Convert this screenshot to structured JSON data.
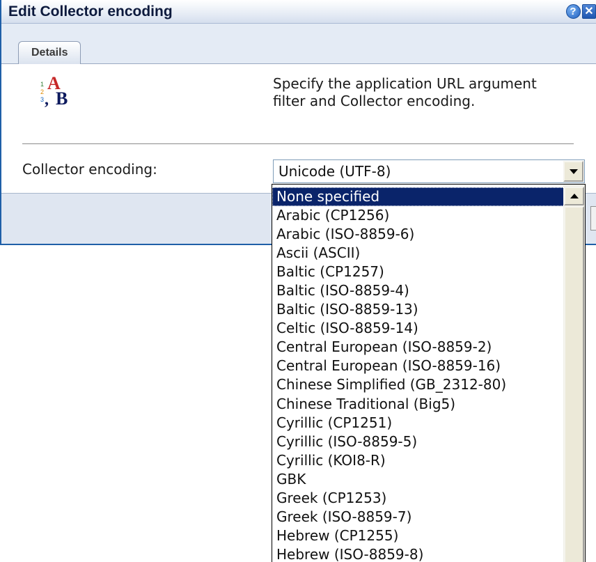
{
  "dialog": {
    "title": "Edit Collector encoding",
    "help_label": "?",
    "close_label": "✕",
    "tabs": [
      {
        "label": "Details"
      }
    ],
    "description": "Specify the application URL argument filter and Collector encoding.",
    "field_label": "Collector encoding:",
    "selected_value": "Unicode (UTF-8)"
  },
  "dropdown": {
    "options": [
      "None specified",
      "Arabic (CP1256)",
      "Arabic (ISO-8859-6)",
      "Ascii (ASCII)",
      "Baltic (CP1257)",
      "Baltic (ISO-8859-4)",
      "Baltic (ISO-8859-13)",
      "Celtic (ISO-8859-14)",
      "Central European (ISO-8859-2)",
      "Central European (ISO-8859-16)",
      "Chinese Simplified (GB_2312-80)",
      "Chinese Traditional (Big5)",
      "Cyrillic (CP1251)",
      "Cyrillic (ISO-8859-5)",
      "Cyrillic (KOI8-R)",
      "GBK",
      "Greek (CP1253)",
      "Greek (ISO-8859-7)",
      "Hebrew (CP1255)",
      "Hebrew (ISO-8859-8)"
    ],
    "highlighted_index": 0
  },
  "icons": {
    "content_icon": "ab-text-encoding-icon",
    "help": "help-icon",
    "close": "close-icon",
    "dropdown_arrow": "chevron-down-icon",
    "scroll_up": "scroll-up-arrow-icon"
  },
  "colors": {
    "title_text": "#0d1a3d",
    "selection_bg": "#0a246a",
    "selection_text": "#ffffff",
    "window_border": "#1f5fa8"
  }
}
